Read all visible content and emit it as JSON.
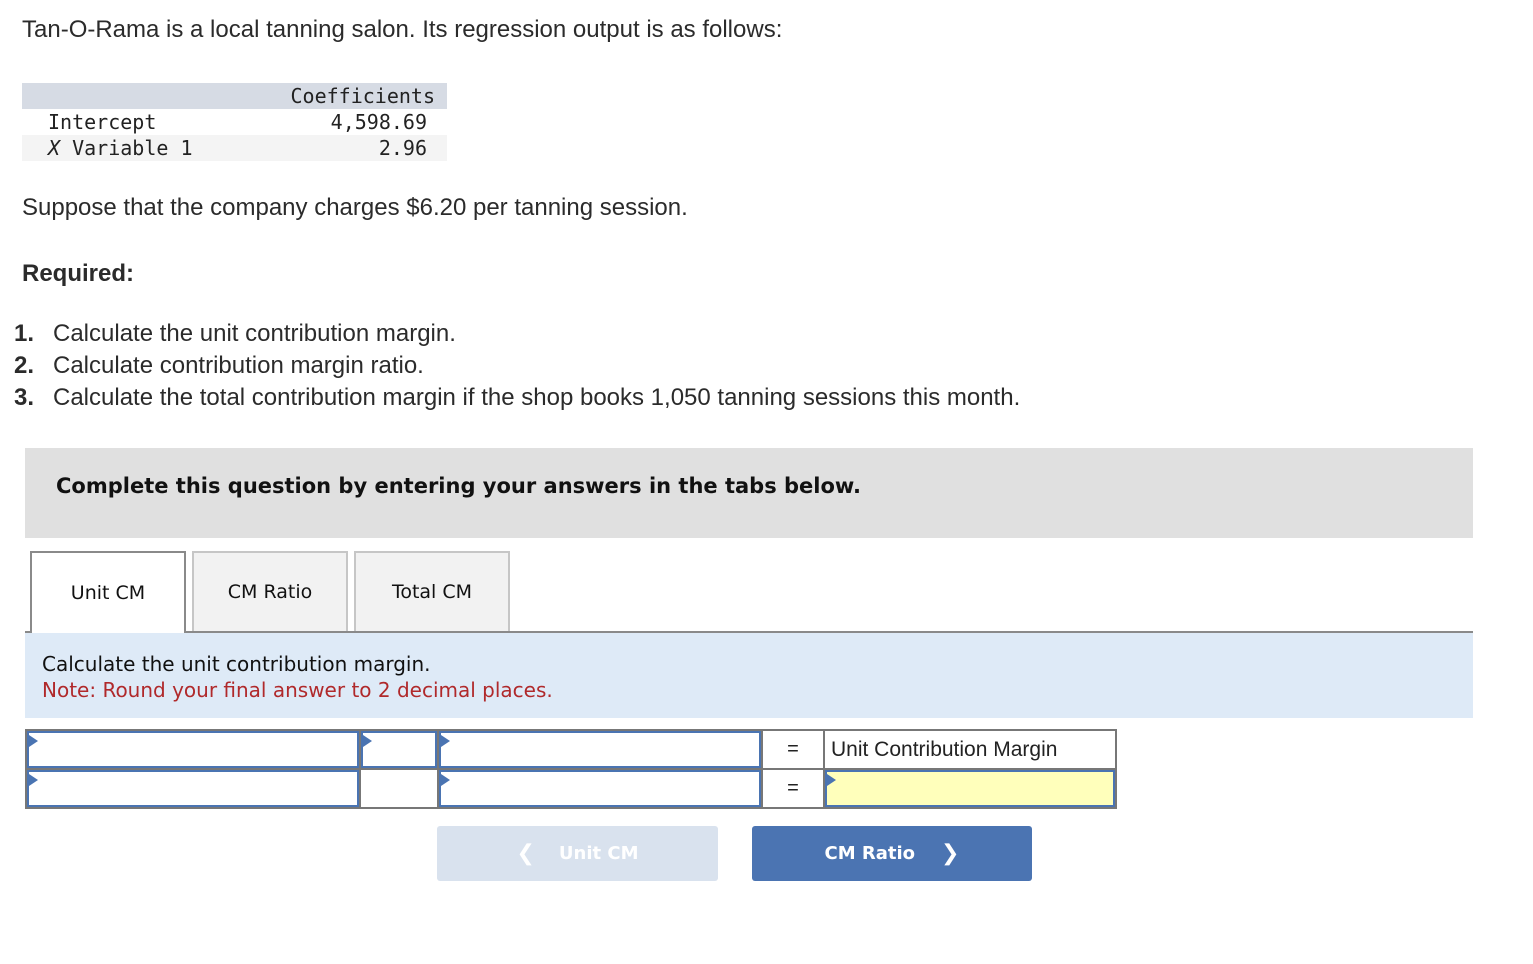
{
  "intro": "Tan-O-Rama is a local tanning salon. Its regression output is as follows:",
  "regression": {
    "header": "Coefficients",
    "rows": [
      {
        "label": "Intercept",
        "value": "4,598.69"
      },
      {
        "label_prefix": "X",
        "label": "Variable 1",
        "value": "2.96"
      }
    ]
  },
  "suppose": "Suppose that the company charges $6.20 per tanning session.",
  "required_heading": "Required:",
  "requirements": [
    {
      "num": "1.",
      "text": "Calculate the unit contribution margin."
    },
    {
      "num": "2.",
      "text": "Calculate contribution margin ratio."
    },
    {
      "num": "3.",
      "text": "Calculate the total contribution margin if the shop books 1,050 tanning sessions this month."
    }
  ],
  "banner": "Complete this question by entering your answers in the tabs below.",
  "tabs": [
    {
      "label": "Unit CM",
      "active": true
    },
    {
      "label": "CM Ratio",
      "active": false
    },
    {
      "label": "Total CM",
      "active": false
    }
  ],
  "panel": {
    "instruction": "Calculate the unit contribution margin.",
    "note": "Note: Round your final answer to 2 decimal places."
  },
  "worksheet": {
    "equals": "=",
    "result_label": "Unit Contribution Margin",
    "inputs": {
      "row1_col1": "",
      "row1_col2": "",
      "row1_col3": "",
      "row2_col1": "",
      "row2_col3": "",
      "row2_result": ""
    }
  },
  "nav": {
    "prev_label": "Unit CM",
    "next_label": "CM Ratio",
    "prev_icon": "chevron-left-icon",
    "next_icon": "chevron-right-icon"
  },
  "colors": {
    "accent": "#4b74b2",
    "note": "#b0292b",
    "panel_bg": "#deeaf7",
    "answer_bg": "#ffffbb"
  }
}
